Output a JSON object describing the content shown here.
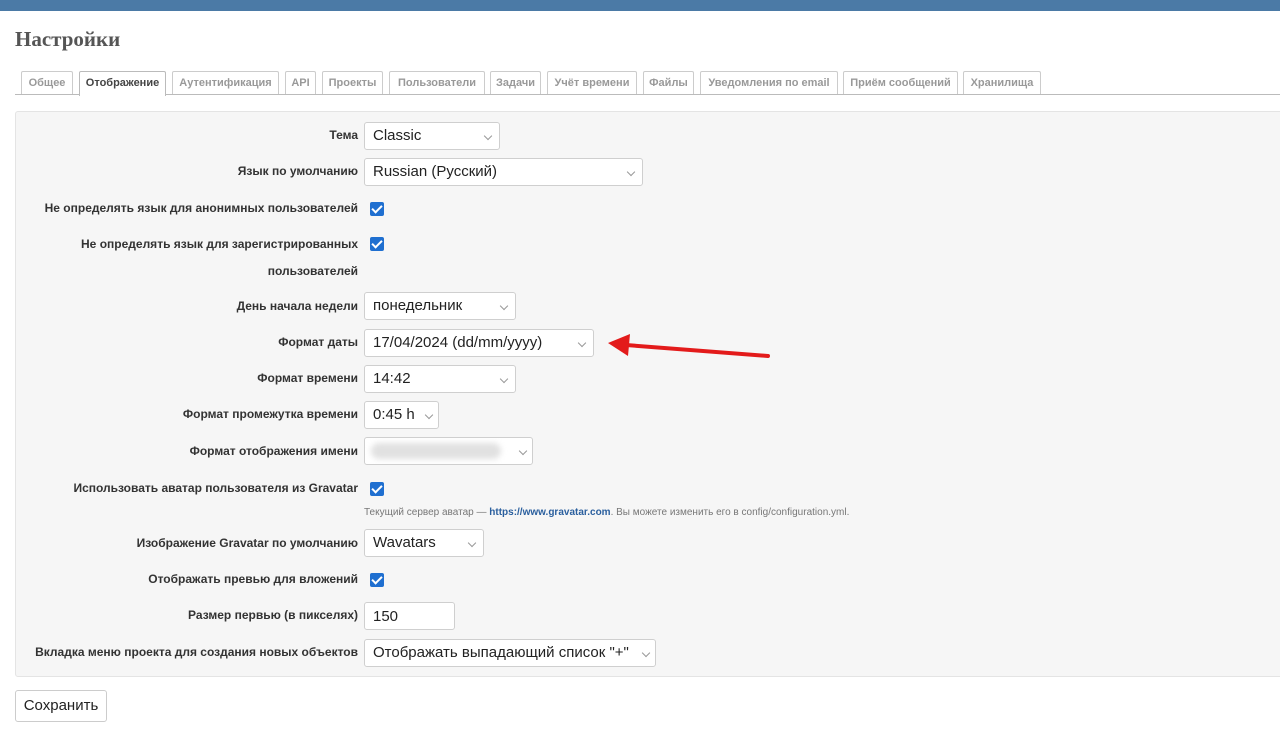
{
  "page": {
    "title": "Настройки"
  },
  "tabs": [
    {
      "label": "Общее"
    },
    {
      "label": "Отображение"
    },
    {
      "label": "Аутентификация"
    },
    {
      "label": "API"
    },
    {
      "label": "Проекты"
    },
    {
      "label": "Пользователи"
    },
    {
      "label": "Задачи"
    },
    {
      "label": "Учёт времени"
    },
    {
      "label": "Файлы"
    },
    {
      "label": "Уведомления по email"
    },
    {
      "label": "Приём сообщений"
    },
    {
      "label": "Хранилища"
    }
  ],
  "selected_tab": "Отображение",
  "fields": {
    "theme": {
      "label": "Тема",
      "value": "Classic"
    },
    "default_language": {
      "label": "Язык по умолчанию",
      "value": "Russian (Русский)"
    },
    "no_lang_anonymous": {
      "label": "Не определять язык для анонимных пользователей",
      "checked": true
    },
    "no_lang_registered": {
      "label_line1": "Не определять язык для зарегистрированных",
      "label_line2": "пользователей",
      "checked": true
    },
    "week_start": {
      "label": "День начала недели",
      "value": "понедельник"
    },
    "date_format": {
      "label": "Формат даты",
      "value": "17/04/2024 (dd/mm/yyyy)"
    },
    "time_format": {
      "label": "Формат времени",
      "value": "14:42"
    },
    "timespan_format": {
      "label": "Формат промежутка времени",
      "value": "0:45 h"
    },
    "user_name_format": {
      "label": "Формат отображения имени",
      "value": ""
    },
    "gravatar_enabled": {
      "label": "Использовать аватар пользователя из Gravatar",
      "checked": true,
      "hint_prefix": "Текущий сервер аватар — ",
      "hint_link": "https://www.gravatar.com",
      "hint_suffix": ". Вы можете изменить его в config/configuration.yml."
    },
    "gravatar_default": {
      "label": "Изображение Gravatar по умолчанию",
      "value": "Wavatars"
    },
    "thumbnails_enabled": {
      "label": "Отображать превью для вложений",
      "checked": true
    },
    "thumbnails_size": {
      "label": "Размер первью (в пикселях)",
      "value": "150"
    },
    "new_item_menu_tab": {
      "label": "Вкладка меню проекта для создания новых объектов",
      "value": "Отображать выпадающий список \"+\""
    }
  },
  "actions": {
    "save_label": "Сохранить"
  },
  "colors": {
    "topbar": "#4b7aa6",
    "checkbox": "#1f6fd0",
    "link": "#2a5f9e",
    "annotation_arrow": "#e31b1b",
    "panel_background": "#f6f6f6"
  }
}
